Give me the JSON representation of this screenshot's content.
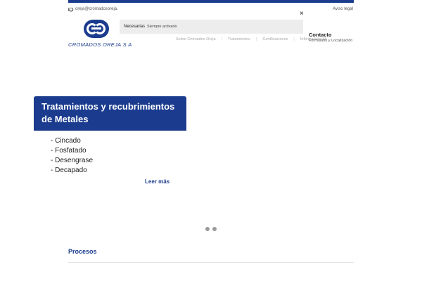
{
  "header": {
    "email": "oreja@cromadosoreja.",
    "aviso_legal": "Aviso legal",
    "brand_name": "CROMADOS OREJA S.A"
  },
  "cookie": {
    "category": "Necesarias",
    "status": "Siempre activado",
    "close": "×"
  },
  "nav": {
    "items": [
      "Sobre Cromados Oreja",
      "Tratamientos",
      "Certificaciones",
      "Información útil"
    ]
  },
  "contact": {
    "title": "Contacto",
    "subtitle": "Formulario y Localización"
  },
  "hero": {
    "title": "Tratamientos y recubrimientos de Metales",
    "items": [
      "- Cincado",
      "- Fosfatado",
      "- Desengrase",
      "- Decapado"
    ],
    "cta": "Leer más"
  },
  "slider": {
    "dot_count": 2
  },
  "section": {
    "title": "Procesos"
  },
  "colors": {
    "brand": "#1b3c8e",
    "cookie_bg": "#ededed"
  }
}
